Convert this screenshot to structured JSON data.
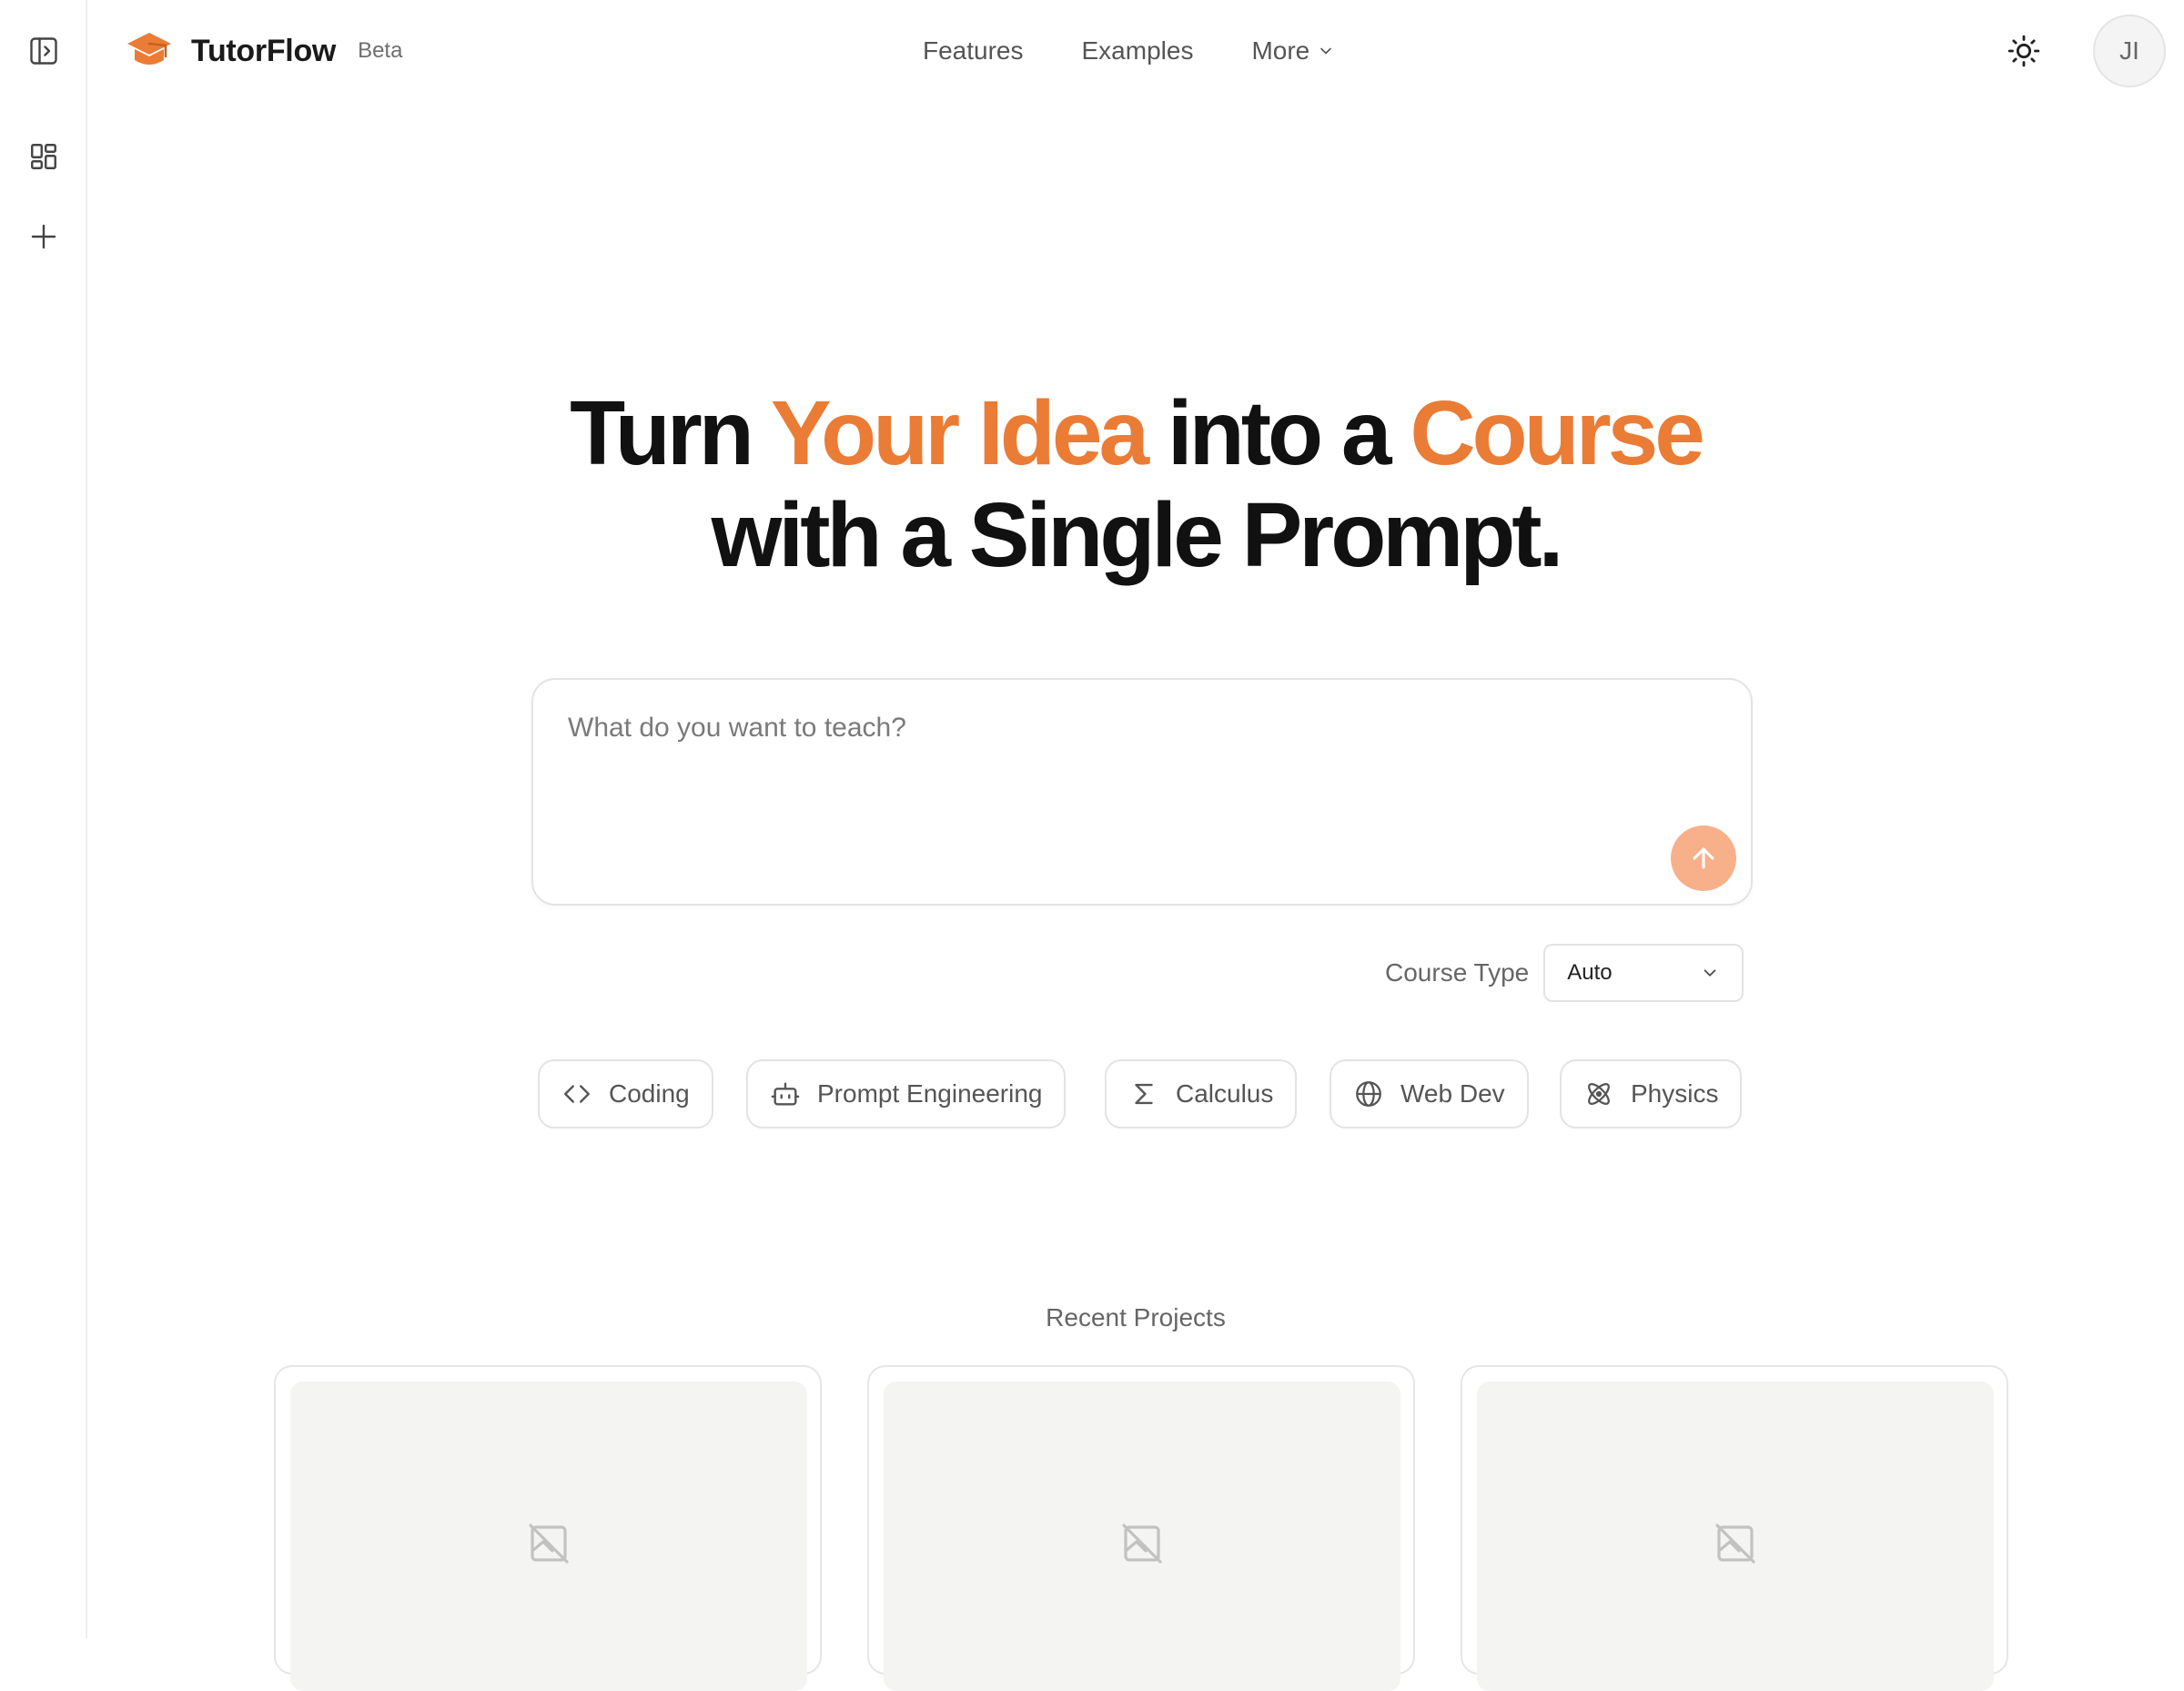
{
  "brand": {
    "name": "TutorFlow",
    "badge": "Beta",
    "accent": "#ea7c36"
  },
  "nav": {
    "items": [
      "Features",
      "Examples",
      "More"
    ]
  },
  "user": {
    "initials": "JI"
  },
  "icons": {
    "rail": [
      "sidebar-toggle-icon",
      "dashboard-icon",
      "plus-icon"
    ],
    "header": [
      "graduation-cap-icon",
      "chevron-down-icon",
      "sun-icon"
    ]
  },
  "hero": {
    "line1": [
      "Turn ",
      "Your Idea",
      " into a ",
      "Course"
    ],
    "line2": "with a Single Prompt."
  },
  "prompt": {
    "placeholder": "What do you want to teach?",
    "send_color": "#f8b08b"
  },
  "course_type": {
    "label": "Course Type",
    "selected": "Auto"
  },
  "chips": [
    {
      "label": "Coding",
      "icon": "code-icon"
    },
    {
      "label": "Prompt Engineering",
      "icon": "robot-icon"
    },
    {
      "label": "Calculus",
      "icon": "sigma-icon"
    },
    {
      "label": "Web Dev",
      "icon": "globe-icon"
    },
    {
      "label": "Physics",
      "icon": "atom-icon"
    }
  ],
  "recent": {
    "title": "Recent Projects"
  }
}
